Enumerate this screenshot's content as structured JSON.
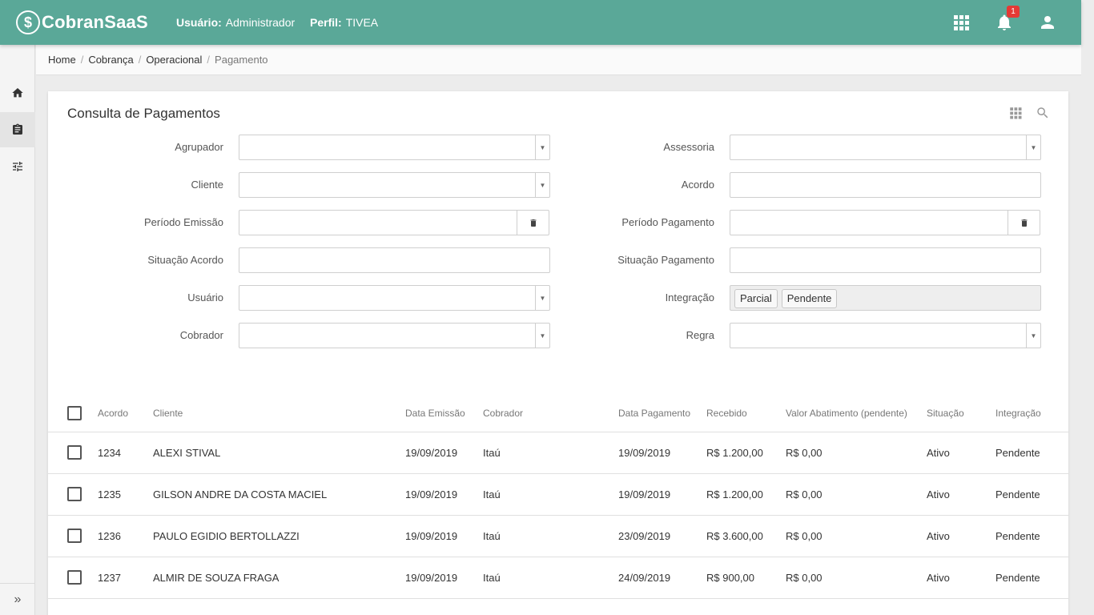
{
  "app": {
    "logo_glyph": "$",
    "name": "CobranSaaS"
  },
  "header": {
    "user_label": "Usuário:",
    "user_value": "Administrador",
    "profile_label": "Perfil:",
    "profile_value": "TIVEA",
    "notification_count": "1",
    "icons": [
      "apps-icon",
      "bell-icon",
      "account-icon"
    ]
  },
  "sidebar": {
    "items": [
      "home-icon",
      "clipboard-icon",
      "tune-icon"
    ],
    "expand_glyph": "»"
  },
  "breadcrumb": [
    "Home",
    "Cobrança",
    "Operacional",
    "Pagamento"
  ],
  "page": {
    "title": "Consulta de Pagamentos"
  },
  "filters": {
    "agrupador": "Agrupador",
    "assessoria": "Assessoria",
    "cliente": "Cliente",
    "acordo": "Acordo",
    "periodo_emissao": "Período Emissão",
    "periodo_pagamento": "Período Pagamento",
    "situacao_acordo": "Situação Acordo",
    "situacao_pagamento": "Situação Pagamento",
    "usuario": "Usuário",
    "integracao": "Integração",
    "integracao_values": [
      "Parcial",
      "Pendente"
    ],
    "cobrador": "Cobrador",
    "regra": "Regra"
  },
  "table": {
    "columns": [
      "Acordo",
      "Cliente",
      "Data Emissão",
      "Cobrador",
      "Data Pagamento",
      "Recebido",
      "Valor Abatimento (pendente)",
      "Situação",
      "Integração"
    ],
    "rows": [
      [
        "1234",
        "ALEXI STIVAL",
        "19/09/2019",
        "Itaú",
        "19/09/2019",
        "R$ 1.200,00",
        "R$ 0,00",
        "Ativo",
        "Pendente"
      ],
      [
        "1235",
        "GILSON ANDRE DA COSTA MACIEL",
        "19/09/2019",
        "Itaú",
        "19/09/2019",
        "R$ 1.200,00",
        "R$ 0,00",
        "Ativo",
        "Pendente"
      ],
      [
        "1236",
        "PAULO EGIDIO BERTOLLAZZI",
        "19/09/2019",
        "Itaú",
        "23/09/2019",
        "R$ 3.600,00",
        "R$ 0,00",
        "Ativo",
        "Pendente"
      ],
      [
        "1237",
        "ALMIR DE SOUZA FRAGA",
        "19/09/2019",
        "Itaú",
        "24/09/2019",
        "R$ 900,00",
        "R$ 0,00",
        "Ativo",
        "Pendente"
      ]
    ]
  }
}
